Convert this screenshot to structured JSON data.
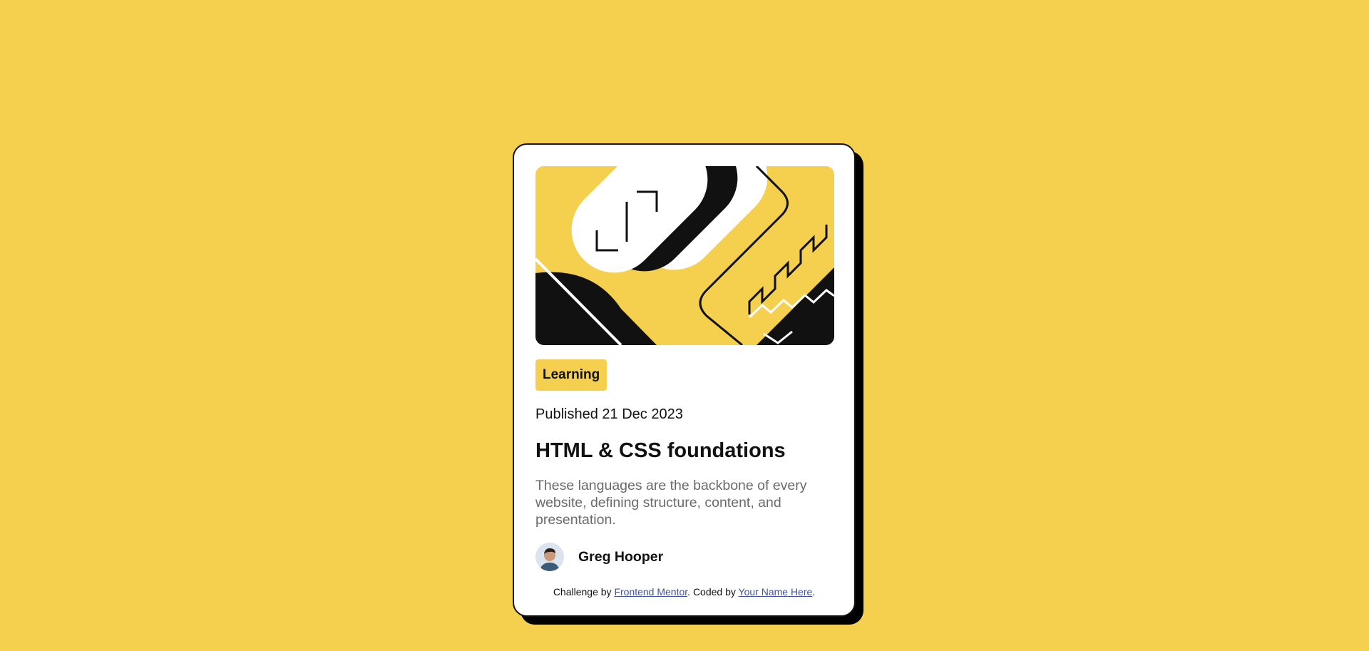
{
  "colors": {
    "background": "#f4d04e",
    "card": "#ffffff",
    "text": "#111111",
    "muted": "#6b6b6b",
    "link": "#3e52a3"
  },
  "card": {
    "hero_image": "abstract-illustration-icon",
    "tag": "Learning",
    "published": "Published 21 Dec 2023",
    "title": "HTML & CSS foundations",
    "description": "These languages are the backbone of every website, defining structure, content, and presentation.",
    "author": {
      "avatar": "avatar-icon",
      "name": "Greg Hooper"
    }
  },
  "attribution": {
    "prefix": "Challenge by ",
    "link1": "Frontend Mentor",
    "middle": ". Coded by ",
    "link2": "Your Name Here",
    "suffix": "."
  }
}
